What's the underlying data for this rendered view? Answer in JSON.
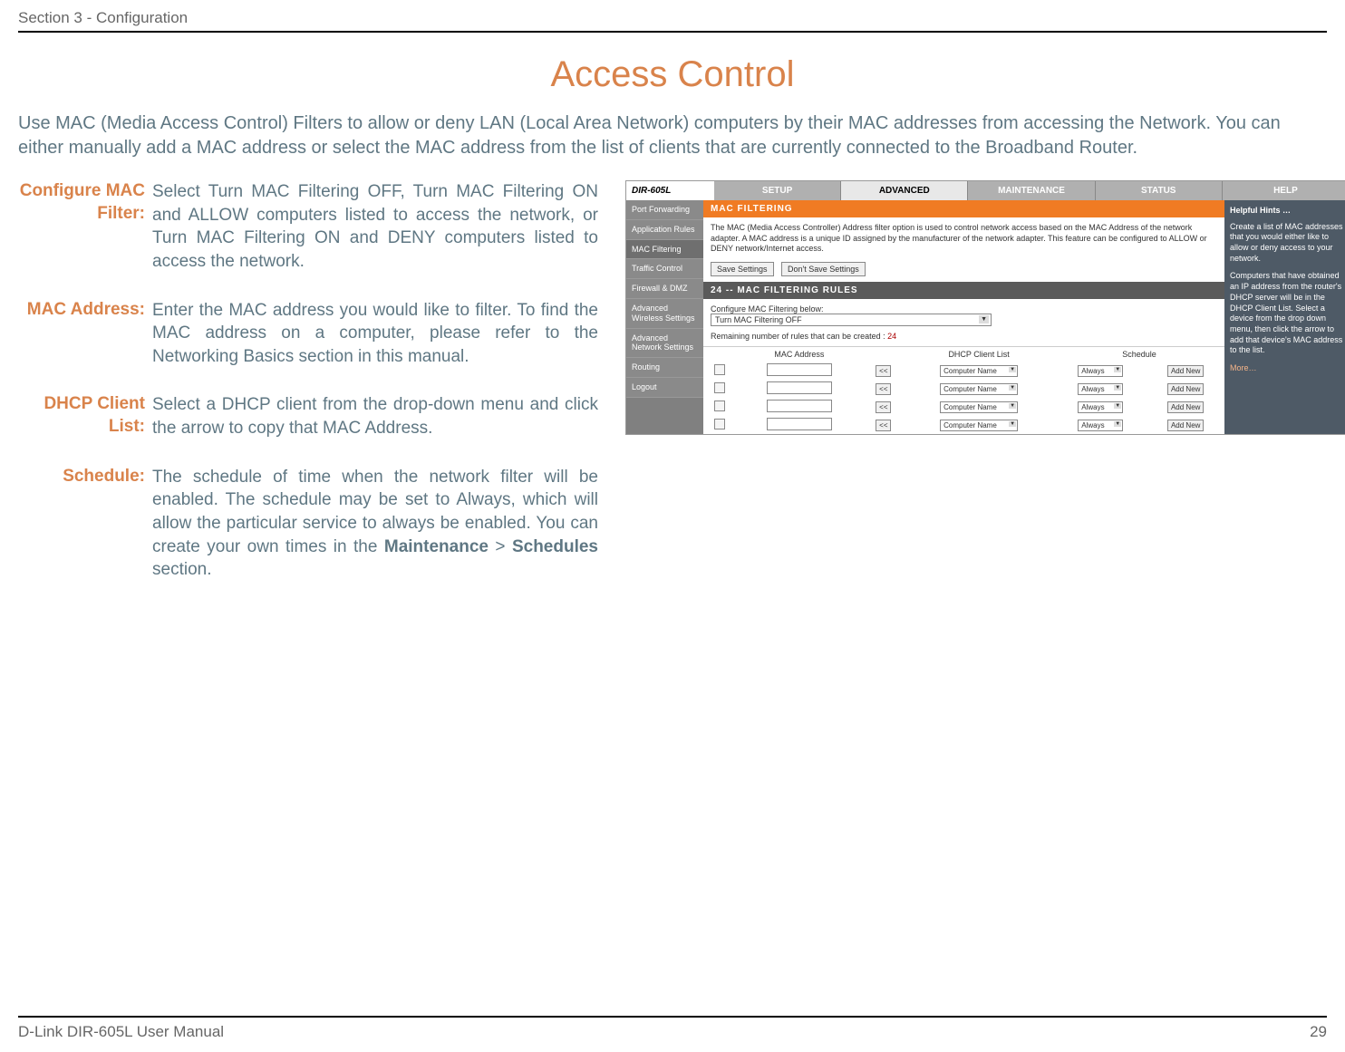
{
  "header": {
    "section": "Section 3 - Configuration"
  },
  "title": "Access Control",
  "intro": "Use MAC (Media Access Control) Filters to allow or deny LAN (Local Area Network) computers by their MAC addresses from accessing the Network. You can either manually add a MAC address or select the MAC address from the list of clients that are currently connected to the Broadband Router.",
  "defs": {
    "configure_label": "Configure MAC Filter:",
    "configure_body": "Select Turn MAC Filtering OFF, Turn MAC Filtering ON and ALLOW computers listed to access the network, or Turn MAC Filtering ON and DENY computers listed to access the network.",
    "mac_label": "MAC Address:",
    "mac_body": "Enter the MAC address you would like to filter. To find the MAC address on a computer, please refer to the Networking Basics section in this manual.",
    "dhcp_label": "DHCP Client List:",
    "dhcp_body": "Select a DHCP client from the drop-down menu and click the arrow to copy that MAC Address.",
    "schedule_label": "Schedule:",
    "schedule_body_pre": "The schedule of time when the network filter will be enabled. The schedule may be set to Always, which will allow the particular service to always be enabled. You can create your own times in the ",
    "schedule_bold1": "Maintenance",
    "schedule_gt": " > ",
    "schedule_bold2": "Schedules",
    "schedule_body_post": " section."
  },
  "router": {
    "model": "DIR-605L",
    "tabs": [
      "SETUP",
      "ADVANCED",
      "MAINTENANCE",
      "STATUS",
      "HELP"
    ],
    "nav": [
      "Port Forwarding",
      "Application Rules",
      "MAC Filtering",
      "Traffic Control",
      "Firewall & DMZ",
      "Advanced Wireless Settings",
      "Advanced Network Settings",
      "Routing",
      "Logout"
    ],
    "panel1_title": "MAC FILTERING",
    "panel1_desc": "The MAC (Media Access Controller) Address filter option is used to control network access based on the MAC Address of the network adapter. A MAC address is a unique ID assigned by the manufacturer of the network adapter. This feature can be configured to ALLOW or DENY network/Internet access.",
    "save_btn": "Save Settings",
    "dontsave_btn": "Don't Save Settings",
    "panel2_title": "24 -- MAC FILTERING RULES",
    "cfg_label": "Configure MAC Filtering below:",
    "cfg_select": "Turn MAC Filtering OFF",
    "remaining_pre": "Remaining number of rules that can be created : ",
    "remaining_count": "24",
    "th_mac": "MAC Address",
    "th_dhcp": "DHCP Client List",
    "th_sched": "Schedule",
    "copy_btn": "<<",
    "client_sel": "Computer Name",
    "sched_sel": "Always",
    "addnew_btn": "Add New",
    "help_title": "Helpful Hints …",
    "help_p1": "Create a list of MAC addresses that you would either like to allow or deny access to your network.",
    "help_p2": "Computers that have obtained an IP address from the router's DHCP server will be in the DHCP Client List. Select a device from the drop down menu, then click the arrow to add that device's MAC address to the list.",
    "help_more": "More…"
  },
  "footer": {
    "left": "D-Link DIR-605L User Manual",
    "right": "29"
  }
}
